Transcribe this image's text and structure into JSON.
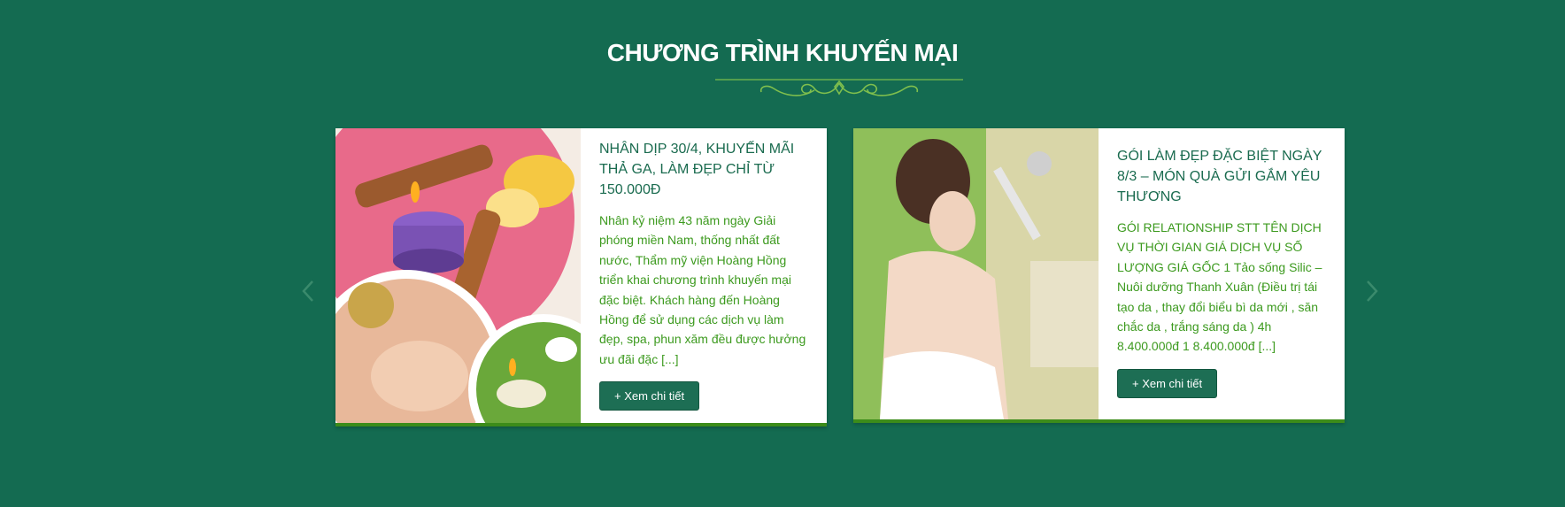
{
  "section": {
    "title": "CHƯƠNG TRÌNH KHUYẾN MẠI"
  },
  "carousel": {
    "prev_icon": "chevron-left-icon",
    "next_icon": "chevron-right-icon",
    "cards": [
      {
        "title": "NHÂN DỊP 30/4, KHUYẾN MÃI THẢ GA, LÀM ĐẸP CHỈ TỪ 150.000Đ",
        "excerpt": "Nhân kỷ niệm 43 năm ngày Giải phóng miền Nam, thống nhất đất nước, Thẩm mỹ viện Hoàng Hồng triển khai chương trình khuyến mại đặc biệt. Khách hàng đến Hoàng Hồng để sử dụng các dịch vụ làm đẹp, spa, phun xăm đều được hưởng ưu đãi đặc [...]",
        "button": "+ Xem chi tiết"
      },
      {
        "title": "GÓI LÀM ĐẸP ĐẶC BIỆT NGÀY 8/3 – MÓN QUÀ GỬI GẮM YÊU THƯƠNG",
        "excerpt": "GÓI RELATIONSHIP STT TÊN DỊCH VỤ THỜI GIAN GIÁ DỊCH VỤ SỐ LƯỢNG GIÁ GỐC 1 Tảo sống Silic – Nuôi dưỡng Thanh Xuân (Điều trị tái tạo da , thay đổi biểu bì da mới , săn chắc da , trắng sáng da ) 4h 8.400.000đ 1 8.400.000đ [...]",
        "button": "+ Xem chi tiết"
      }
    ]
  },
  "colors": {
    "background": "#146b51",
    "title_text": "#1a6b4f",
    "excerpt_text": "#3c9a1e",
    "button_bg": "#1d6e54",
    "card_border": "#3c8c1a"
  }
}
